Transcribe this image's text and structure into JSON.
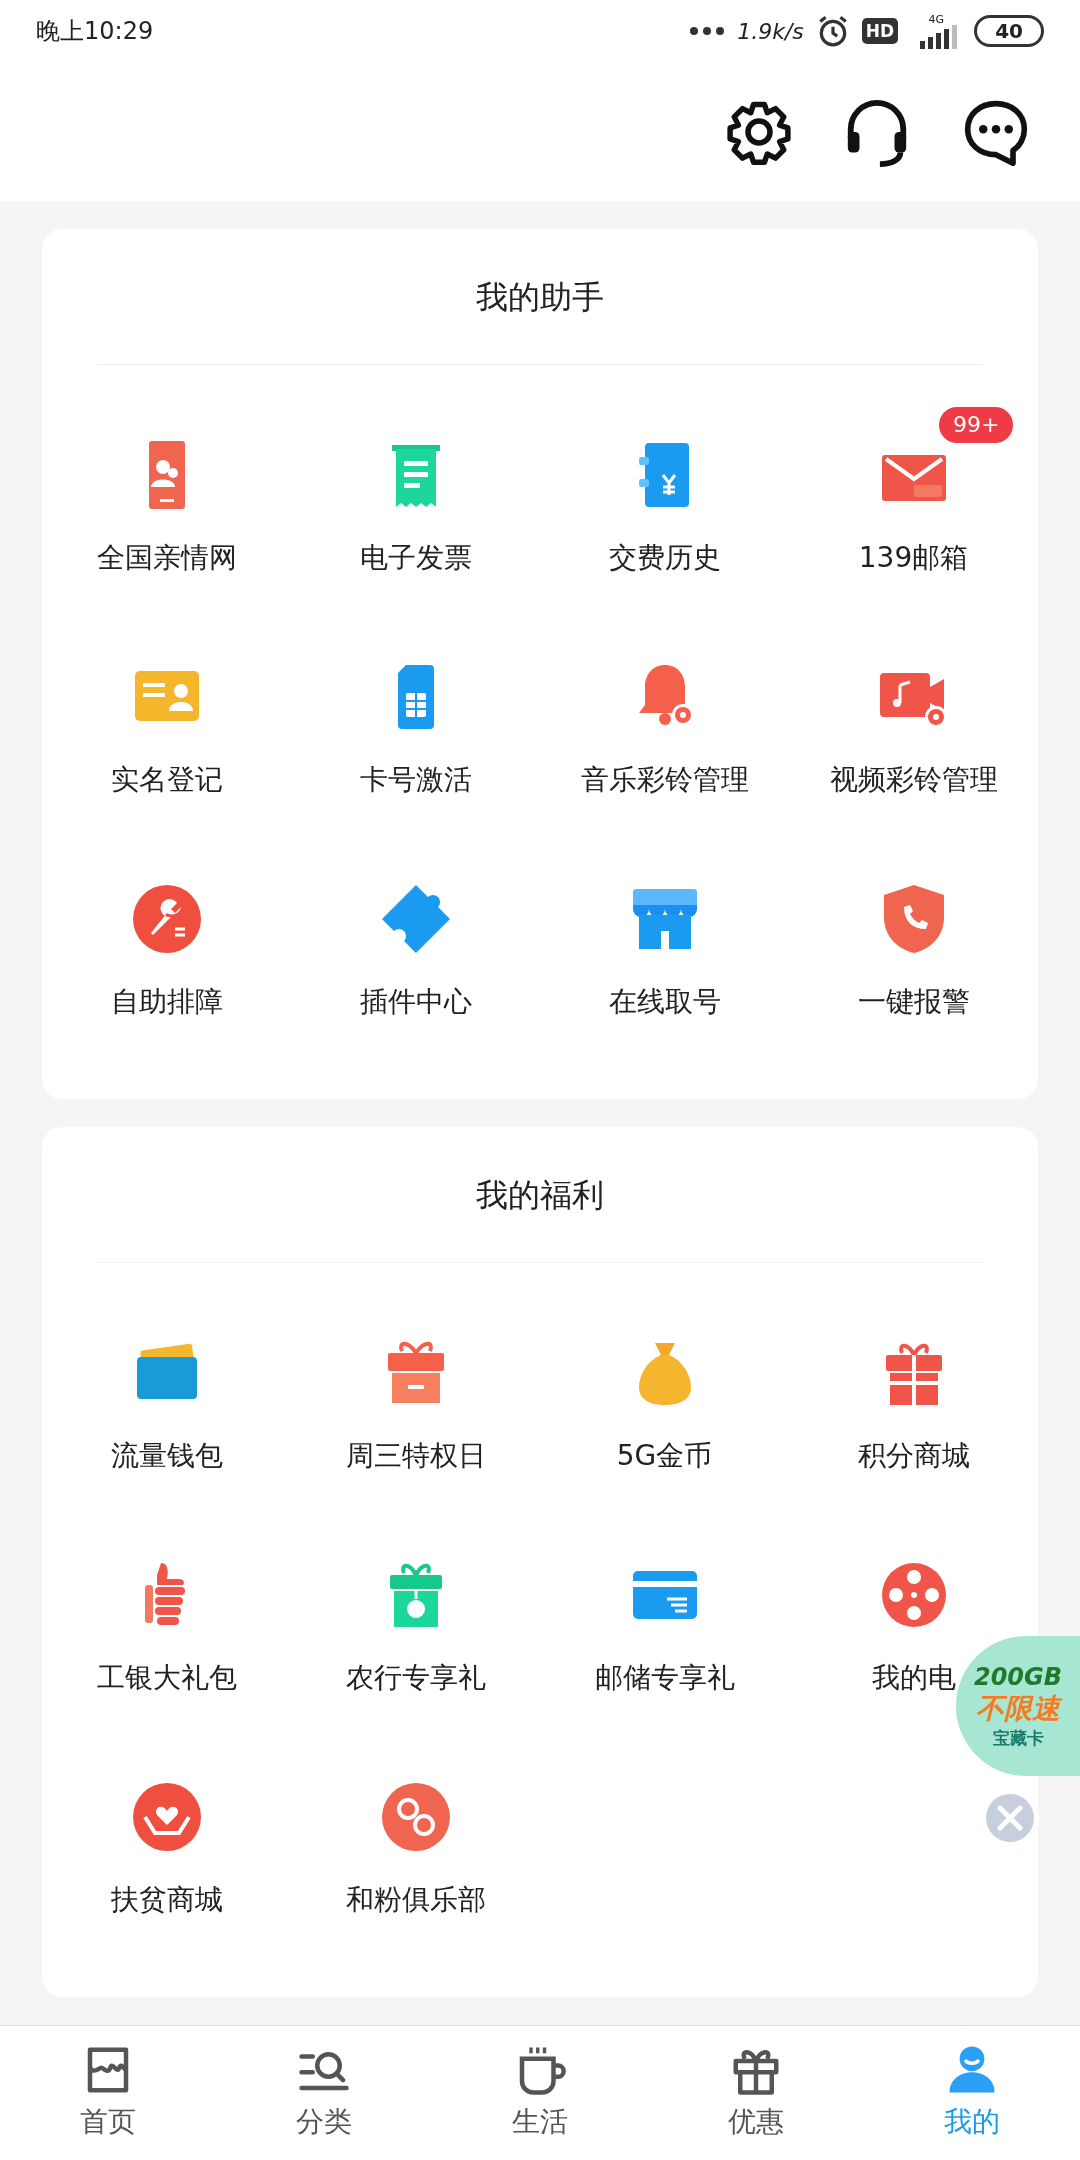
{
  "status_bar": {
    "time": "晚上10:29",
    "speed": "1.9k/s",
    "hd": "HD",
    "network": "4G",
    "battery": "40"
  },
  "sections": [
    {
      "title": "我的助手",
      "items": [
        {
          "label": "全国亲情网"
        },
        {
          "label": "电子发票"
        },
        {
          "label": "交费历史"
        },
        {
          "label": "139邮箱",
          "badge": "99+"
        },
        {
          "label": "实名登记"
        },
        {
          "label": "卡号激活"
        },
        {
          "label": "音乐彩铃管理"
        },
        {
          "label": "视频彩铃管理"
        },
        {
          "label": "自助排障"
        },
        {
          "label": "插件中心"
        },
        {
          "label": "在线取号"
        },
        {
          "label": "一键报警"
        }
      ]
    },
    {
      "title": "我的福利",
      "items": [
        {
          "label": "流量钱包"
        },
        {
          "label": "周三特权日"
        },
        {
          "label": "5G金币"
        },
        {
          "label": "积分商城"
        },
        {
          "label": "工银大礼包"
        },
        {
          "label": "农行专享礼"
        },
        {
          "label": "邮储专享礼"
        },
        {
          "label": "我的电"
        },
        {
          "label": "扶贫商城"
        },
        {
          "label": "和粉俱乐部"
        }
      ]
    }
  ],
  "promo": {
    "line_1": "200GB",
    "line_2": "不限速",
    "line_3": "宝藏卡"
  },
  "tabs": [
    {
      "label": "首页",
      "selected": false
    },
    {
      "label": "分类",
      "selected": false
    },
    {
      "label": "生活",
      "selected": false
    },
    {
      "label": "优惠",
      "selected": false
    },
    {
      "label": "我的",
      "selected": true
    }
  ]
}
